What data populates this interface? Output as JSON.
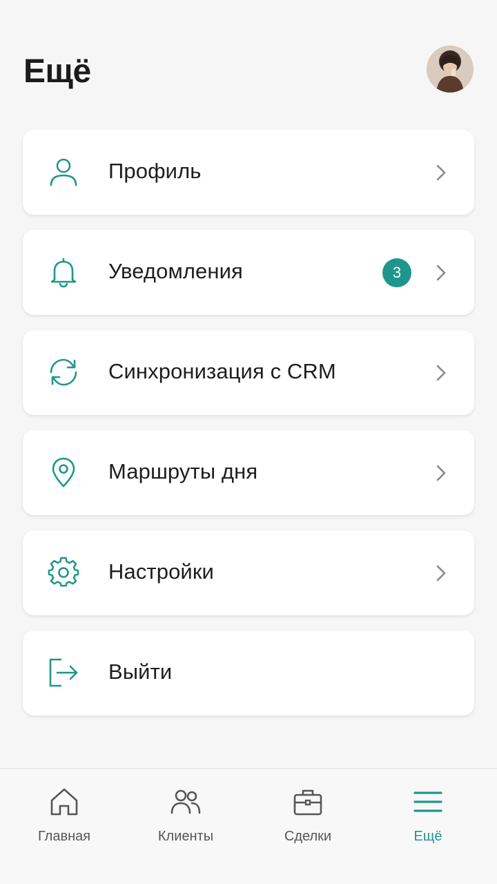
{
  "colors": {
    "accent": "#1f968c",
    "background": "#f6f6f7",
    "card": "#ffffff",
    "text": "#1e1e1e",
    "chevron": "#8a8a8a",
    "tab_inactive": "#555555"
  },
  "header": {
    "title": "Ещё",
    "avatar_icon": "user-avatar-photo"
  },
  "menu": {
    "items": [
      {
        "label": "Профиль",
        "icon": "user-icon",
        "chevron": true
      },
      {
        "label": "Уведомления",
        "icon": "bell-icon",
        "badge": "3",
        "chevron": true
      },
      {
        "label": "Синхронизация с CRM",
        "icon": "sync-icon",
        "chevron": true
      },
      {
        "label": "Маршруты дня",
        "icon": "map-pin-icon",
        "chevron": true
      },
      {
        "label": "Настройки",
        "icon": "gear-icon",
        "chevron": true
      },
      {
        "label": "Выйти",
        "icon": "logout-icon",
        "chevron": false
      }
    ]
  },
  "tabbar": {
    "tabs": [
      {
        "label": "Главная",
        "icon": "home-icon",
        "active": false
      },
      {
        "label": "Клиенты",
        "icon": "users-icon",
        "active": false
      },
      {
        "label": "Сделки",
        "icon": "briefcase-icon",
        "active": false
      },
      {
        "label": "Ещё",
        "icon": "menu-icon",
        "active": true
      }
    ]
  }
}
